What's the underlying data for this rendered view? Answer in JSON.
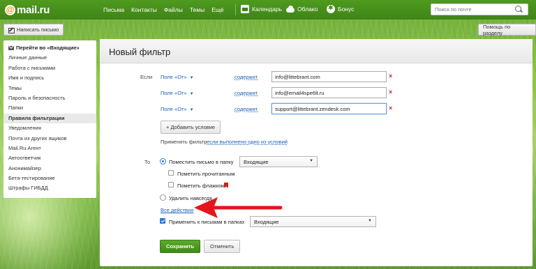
{
  "brand": {
    "at": "@",
    "name": "mail.ru"
  },
  "nav": [
    "Письма",
    "Контакты",
    "Файлы",
    "Темы",
    "Ещё"
  ],
  "services": {
    "calendar": "Календарь",
    "cloud": "Облако",
    "bonus": "Бонус"
  },
  "search": {
    "placeholder": "Поиск по почте"
  },
  "toolbar": {
    "compose": "Написать письмо",
    "help": "Помощь по разделу"
  },
  "sidebar": {
    "back": "Перейти во «Входящие»",
    "items": [
      "Личные данные",
      "Работа с письмами",
      "Имя и подпись",
      "Темы",
      "Пароль и безопасность",
      "Папки",
      "Правила фильтрации",
      "Уведомления",
      "Почта из других ящиков",
      "Mail.Ru Агент",
      "Автоответчик",
      "Анонимайзер",
      "Бета-тестирование",
      "Штрафы ГИБДД"
    ],
    "active_index": 6
  },
  "filter": {
    "title": "Новый фильтр",
    "if_label": "Если",
    "conditions": [
      {
        "field": "Поле «От»",
        "op": "содержит",
        "value": "info@littebrant.com"
      },
      {
        "field": "Поле «От»",
        "op": "содержит",
        "value": "info@email4spe6lt.ru"
      },
      {
        "field": "Поле «От»",
        "op": "содержит",
        "value": "support@littebrant.zendesk.com"
      }
    ],
    "remove_symbol": "×",
    "add_condition": "+ Добавить условие",
    "apply_text": "Применять фильтр",
    "apply_link": "если выполнено одно из условий",
    "to_label": "То",
    "move_label": "Поместить письмо в папку",
    "move_folder": "Входящие",
    "mark_read": "Пометить прочитанным",
    "mark_flag": "Пометить флажком",
    "delete_label": "Удалить навсегда",
    "all_actions": "Все действия",
    "apply_folders_label": "Применить к письмам в папках",
    "apply_folders_value": "Входящие",
    "save": "Сохранить",
    "cancel": "Отменить"
  },
  "colors": {
    "brand_green": "#3f8417",
    "link": "#1a5fb4",
    "remove": "#d12020",
    "arrow": "#e8141c"
  }
}
